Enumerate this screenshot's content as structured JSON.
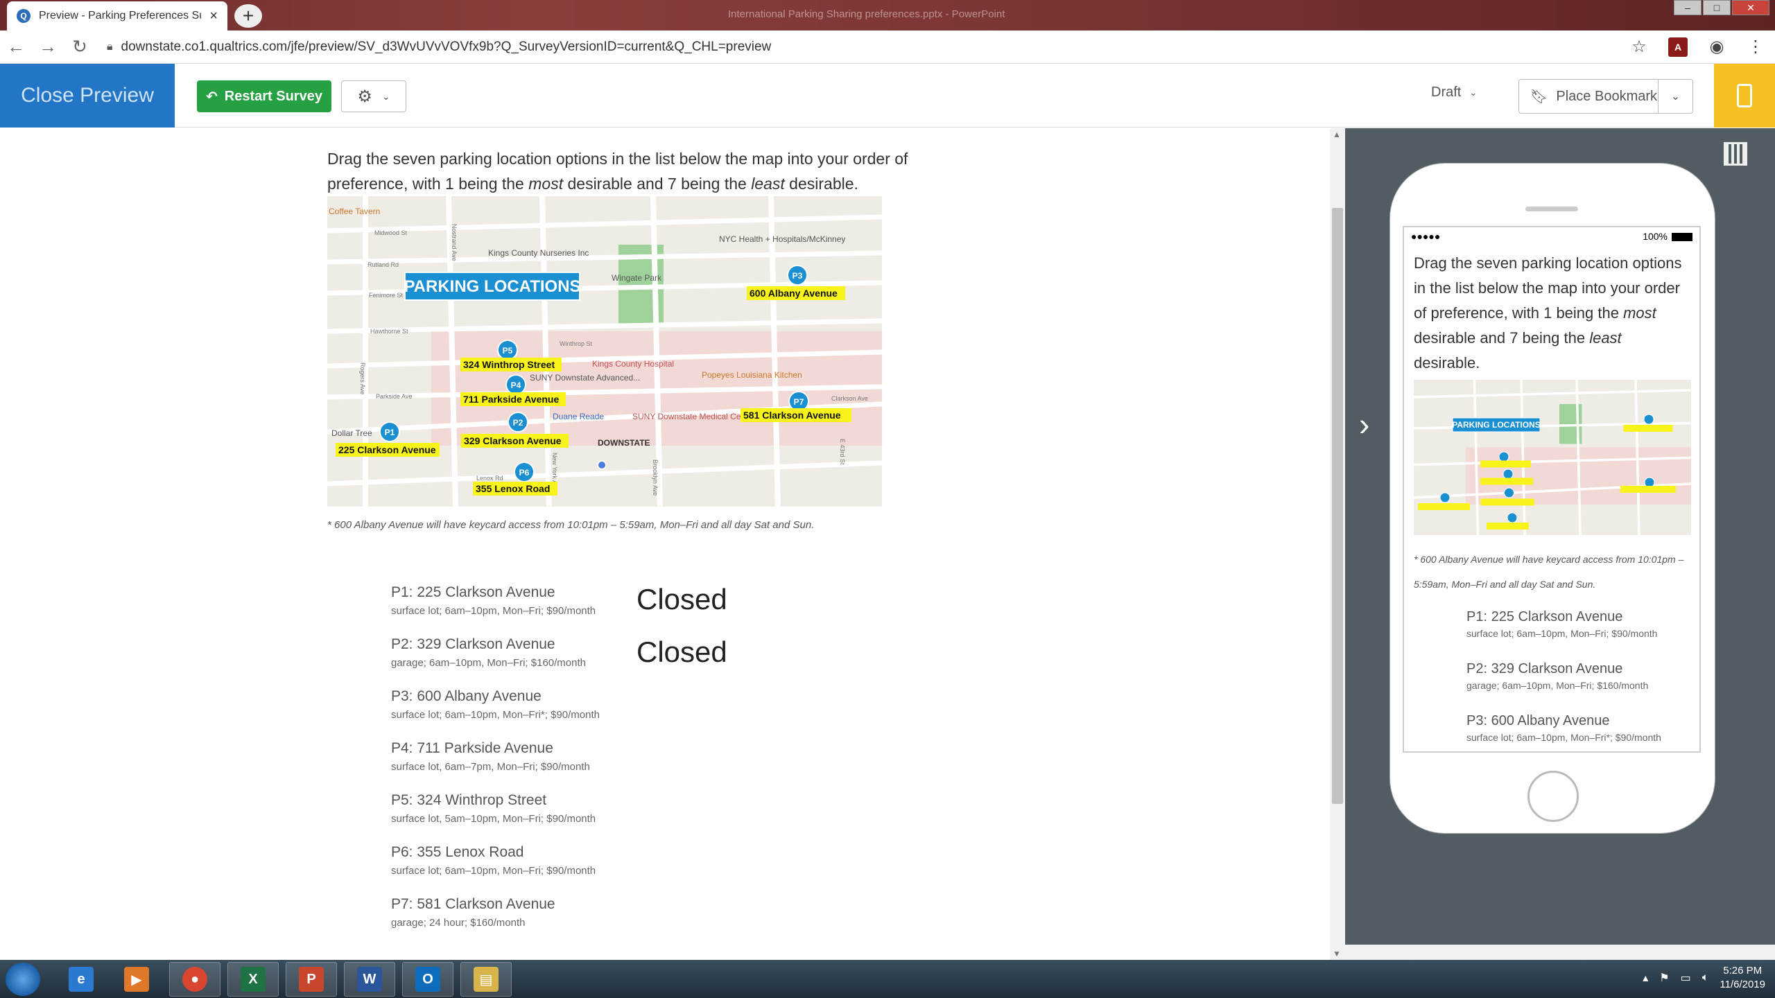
{
  "browser": {
    "tab_title": "Preview - Parking Preferences Su",
    "tab_close": "×",
    "new_tab": "+",
    "window_title": "International Parking Sharing preferences.pptx - PowerPoint",
    "url": "downstate.co1.qualtrics.com/jfe/preview/SV_d3WvUVvVOVfx9b?Q_SurveyVersionID=current&Q_CHL=preview"
  },
  "toolbar": {
    "close_preview": "Close Preview",
    "restart_survey": "Restart Survey",
    "status": "Draft",
    "place_bookmark": "Place Bookmark"
  },
  "question": {
    "text_before": "Drag the seven parking location options in the list below the map into your order of preference, with 1 being the ",
    "most": "most",
    "text_middle": " desirable and 7 being the ",
    "least": "least",
    "text_after": " desirable.",
    "footnote": "* 600 Albany Avenue will have keycard access from 10:01pm – 5:59am, Mon–Fri and all day Sat and Sun."
  },
  "map": {
    "banner": "PARKING LOCATIONS",
    "streets": [
      "Midwood St",
      "Rutland Rd",
      "Fenimore St",
      "Hawthorne St",
      "Winthrop St",
      "Parkside Ave",
      "Clarkson Ave",
      "Lenox Rd",
      "Rogers Ave",
      "Nostrand Ave",
      "New York Ave",
      "Brooklyn Ave",
      "E 43rd St"
    ],
    "pois": [
      "Kings County Nurseries Inc",
      "NYC Health + Hospitals/McKinney",
      "Wingate Park",
      "Kings County Hospital",
      "SUNY Downstate Advanced...",
      "Popeyes Louisiana Kitchen",
      "Duane Reade",
      "SUNY Downstate Medical Center...",
      "Dollar Tree",
      "Coffee Tavern",
      "DOWNSTATE"
    ],
    "markers": [
      {
        "id": "P1",
        "label": "225 Clarkson Avenue"
      },
      {
        "id": "P2",
        "label": "329 Clarkson Avenue"
      },
      {
        "id": "P3",
        "label": "600 Albany Avenue"
      },
      {
        "id": "P4",
        "label": "711 Parkside Avenue"
      },
      {
        "id": "P5",
        "label": "324 Winthrop Street"
      },
      {
        "id": "P6",
        "label": "355 Lenox Road"
      },
      {
        "id": "P7",
        "label": "581 Clarkson Avenue"
      }
    ]
  },
  "options": [
    {
      "title": "P1: 225 Clarkson Avenue",
      "desc": "surface lot; 6am–10pm, Mon–Fri; $90/month",
      "note": "Closed"
    },
    {
      "title": "P2: 329 Clarkson Avenue",
      "desc": "garage; 6am–10pm, Mon–Fri; $160/month",
      "note": "Closed"
    },
    {
      "title": "P3: 600 Albany Avenue",
      "desc": "surface lot; 6am–10pm, Mon–Fri*; $90/month",
      "note": ""
    },
    {
      "title": "P4: 711 Parkside Avenue",
      "desc": "surface lot, 6am–7pm, Mon–Fri; $90/month",
      "note": ""
    },
    {
      "title": "P5: 324 Winthrop Street",
      "desc": "surface lot, 5am–10pm, Mon–Fri; $90/month",
      "note": ""
    },
    {
      "title": "P6: 355 Lenox Road",
      "desc": "surface lot; 6am–10pm, Mon–Fri; $90/month",
      "note": ""
    },
    {
      "title": "P7: 581 Clarkson Avenue",
      "desc": "garage; 24 hour; $160/month",
      "note": ""
    }
  ],
  "mobile": {
    "signal": "●●●●●",
    "battery": "100%"
  },
  "taskbar": {
    "time": "5:26 PM",
    "date": "11/6/2019",
    "apps": [
      {
        "glyph": "e",
        "color": "#2b7ad1",
        "icon": "internet-explorer-icon"
      },
      {
        "glyph": "▶",
        "color": "#e0782a",
        "icon": "media-player-icon"
      },
      {
        "glyph": "●",
        "color": "#d9452f",
        "icon": "chrome-icon"
      },
      {
        "glyph": "X",
        "color": "#1f7244",
        "icon": "excel-icon"
      },
      {
        "glyph": "P",
        "color": "#c8462b",
        "icon": "powerpoint-icon"
      },
      {
        "glyph": "W",
        "color": "#2b579a",
        "icon": "word-icon"
      },
      {
        "glyph": "O",
        "color": "#0f6cbd",
        "icon": "outlook-icon"
      },
      {
        "glyph": "▤",
        "color": "#d9b44a",
        "icon": "file-explorer-icon"
      }
    ]
  }
}
